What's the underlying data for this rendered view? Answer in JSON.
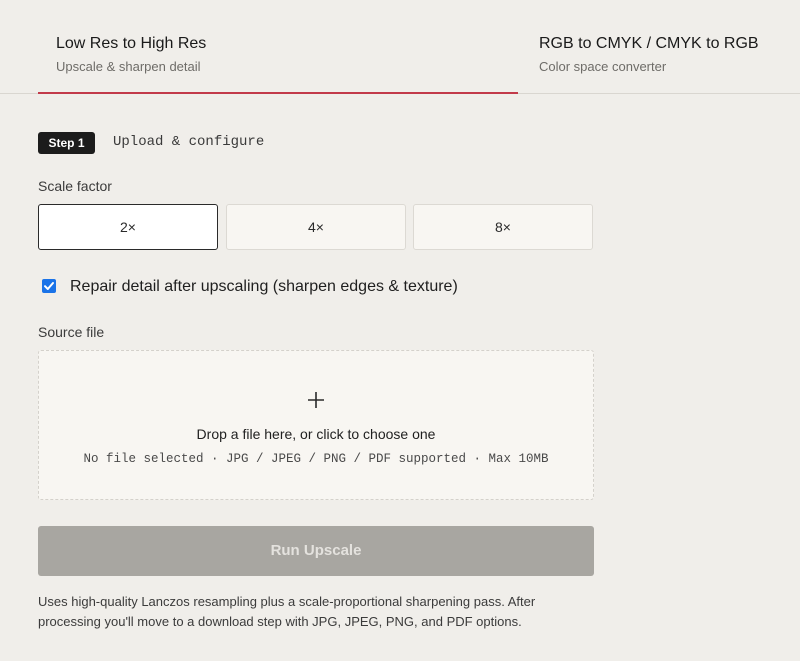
{
  "tabs": [
    {
      "title": "Low Res to High Res",
      "subtitle": "Upscale & sharpen detail",
      "active": true
    },
    {
      "title": "RGB to CMYK / CMYK to RGB",
      "subtitle": "Color space converter",
      "active": false
    }
  ],
  "step": {
    "badge": "Step 1",
    "title": "Upload & configure"
  },
  "scale": {
    "label": "Scale factor",
    "options": [
      "2×",
      "4×",
      "8×"
    ],
    "selected": "2×"
  },
  "repair": {
    "label": "Repair detail after upscaling (sharpen edges & texture)",
    "checked": true
  },
  "source": {
    "label": "Source file",
    "drop_title": "Drop a file here, or click to choose one",
    "drop_subtitle": "No file selected · JPG / JPEG / PNG / PDF supported · Max 10MB"
  },
  "run_button": {
    "label": "Run Upscale",
    "enabled": false
  },
  "help_text": "Uses high-quality Lanczos resampling plus a scale-proportional sharpening pass. After processing you'll move to a download step with JPG, JPEG, PNG, and PDF options.",
  "colors": {
    "accent": "#c23a4a",
    "checkbox": "#1a73e8",
    "disabled_button": "#a8a6a1"
  },
  "icons": {
    "drop": "plus-icon",
    "checkbox": "check-icon"
  }
}
